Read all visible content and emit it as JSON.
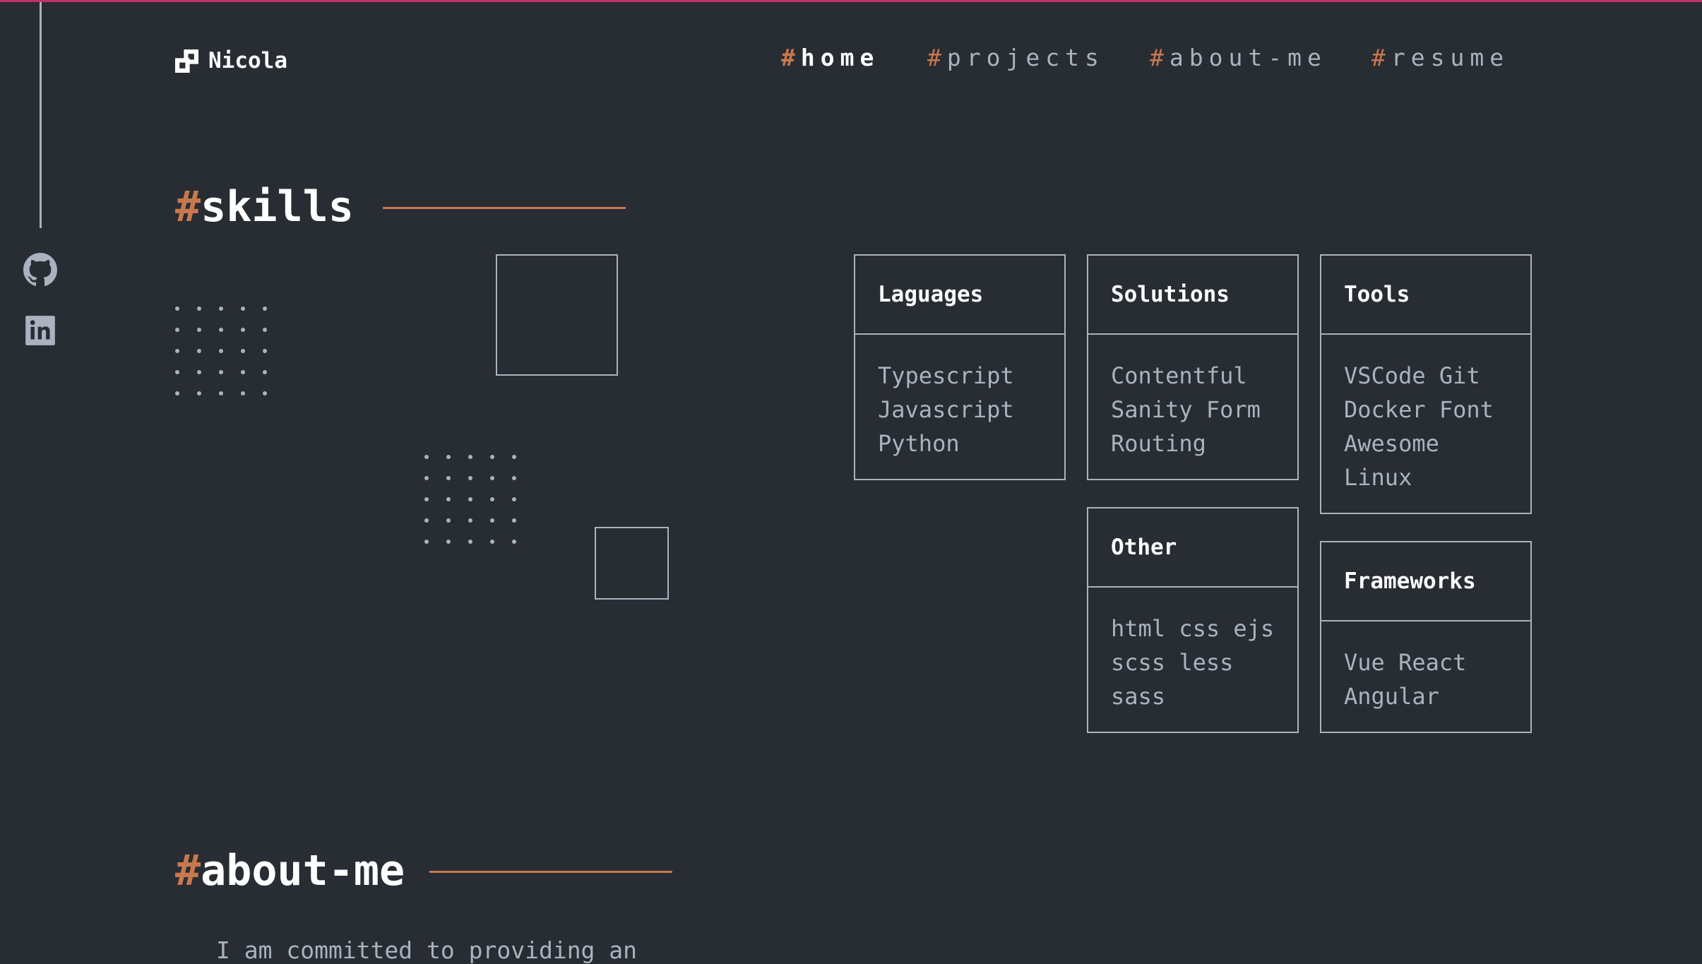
{
  "header": {
    "logo_name": "Nicola",
    "nav": [
      {
        "hash": "#",
        "label": "home",
        "active": true
      },
      {
        "hash": "#",
        "label": "projects",
        "active": false
      },
      {
        "hash": "#",
        "label": "about-me",
        "active": false
      },
      {
        "hash": "#",
        "label": "resume",
        "active": false
      }
    ]
  },
  "social": {
    "github_icon": "github-icon",
    "linkedin_icon": "linkedin-icon"
  },
  "skills": {
    "hash": "#",
    "title": "skills",
    "cards": [
      {
        "title": "Laguages",
        "body": "Typescript Javascript Python"
      },
      {
        "title": "Solutions",
        "body": "Contentful Sanity Form Routing"
      },
      {
        "title": "Tools",
        "body": "VSCode Git Docker Font Awesome Linux"
      },
      {
        "title": "Other",
        "body": "html css ejs scss less sass"
      },
      {
        "title": "Frameworks",
        "body": "Vue React Angular"
      }
    ]
  },
  "about": {
    "hash": "#",
    "title": "about-me",
    "text": "I am committed to providing an"
  },
  "colors": {
    "background": "#282c33",
    "accent": "#c7784e",
    "text": "#abb2bf",
    "heading": "#ffffff",
    "top_bar": "#c0306c"
  }
}
